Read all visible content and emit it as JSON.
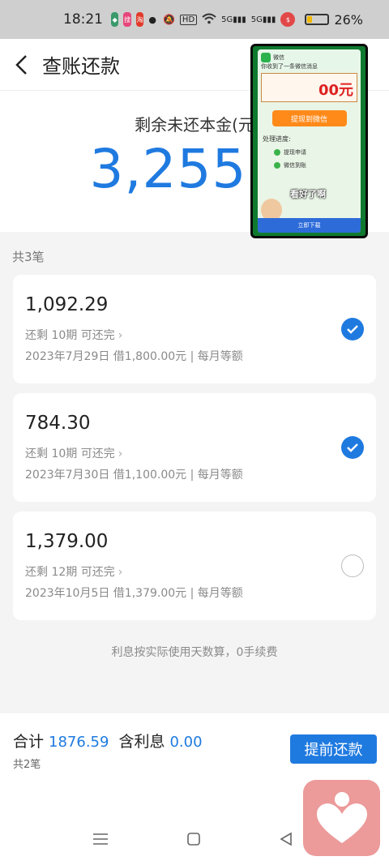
{
  "status_bar": {
    "time": "18:21",
    "hd_label": "HD",
    "signal_label": "5G",
    "battery_percent": "26%",
    "battery_level": 0.26
  },
  "header": {
    "title": "查账还款"
  },
  "summary": {
    "label": "剩余未还本金(元",
    "amount": "3,255.5"
  },
  "overlay": {
    "app_name": "微信",
    "notice": "你收到了一条微信消息",
    "amount": "00元",
    "withdraw_button": "提现到微信",
    "progress_title": "处理进度:",
    "step1": "提现申请",
    "step2": "微信到账",
    "caption": "看好了啊",
    "download_button": "立即下载"
  },
  "list": {
    "count_label": "共3笔",
    "loans": [
      {
        "amount": "1,092.29",
        "terms": "还剩 10期 可还完",
        "meta": "2023年7月29日 借1,800.00元 | 每月等额",
        "selected": true
      },
      {
        "amount": "784.30",
        "terms": "还剩 10期 可还完",
        "meta": "2023年7月30日 借1,100.00元 | 每月等额",
        "selected": true
      },
      {
        "amount": "1,379.00",
        "terms": "还剩 12期 可还完",
        "meta": "2023年10月5日 借1,379.00元 | 每月等额",
        "selected": false
      }
    ]
  },
  "footnote": "利息按实际使用天数算，0手续费",
  "bottom": {
    "total_label": "合计",
    "total_value": "1876.59",
    "interest_label": "含利息",
    "interest_value": "0.00",
    "selected_count": "共2笔",
    "prepay_button": "提前还款"
  },
  "colors": {
    "accent": "#1f7ae0",
    "float_button": "#ec9a9a",
    "overlay_frame": "#0f7a2f"
  }
}
